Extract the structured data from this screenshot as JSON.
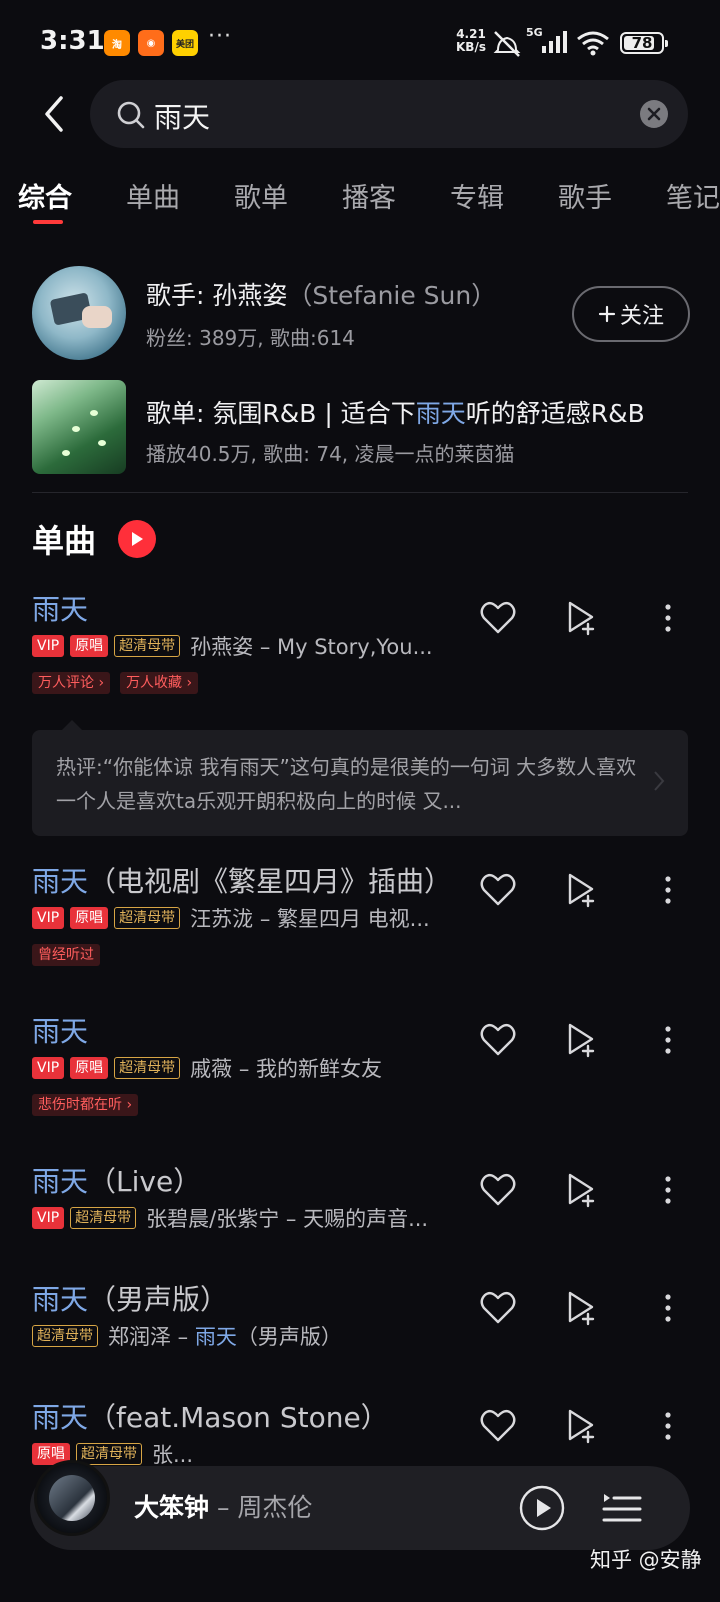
{
  "status_bar": {
    "time": "3:31",
    "apps": [
      {
        "name": "taobao-icon",
        "color": "#ff8a00",
        "glyph": "淘"
      },
      {
        "name": "app-icon",
        "color": "#ff6d1a",
        "glyph": "◉"
      },
      {
        "name": "meituan-icon",
        "color": "#ffd000",
        "glyph": "美团"
      }
    ],
    "more": "···",
    "net_speed_value": "4.21",
    "net_speed_unit": "KB/s",
    "network": "5G",
    "battery": "78"
  },
  "search": {
    "query": "雨天"
  },
  "tabs": [
    {
      "label": "综合",
      "active": true
    },
    {
      "label": "单曲",
      "active": false
    },
    {
      "label": "歌单",
      "active": false
    },
    {
      "label": "播客",
      "active": false
    },
    {
      "label": "专辑",
      "active": false
    },
    {
      "label": "歌手",
      "active": false
    },
    {
      "label": "笔记",
      "active": false
    }
  ],
  "artist_card": {
    "prefix": "歌手: ",
    "name": "孙燕姿",
    "en_name": "（Stefanie Sun）",
    "stats": "粉丝: 389万, 歌曲:614",
    "follow_label": "关注"
  },
  "playlist_card": {
    "title_before": "歌单: 氛围R&B | 适合下",
    "title_highlight": "雨天",
    "title_after": "听的舒适感R&B",
    "stats": "播放40.5万, 歌曲: 74, 凌晨一点的莱茵猫"
  },
  "section": {
    "title": "单曲"
  },
  "songs": [
    {
      "title": "雨天",
      "subtitle": "",
      "badges": [
        "VIP",
        "原唱",
        "超清母带"
      ],
      "artist": "孙燕姿 – My Story,You...",
      "tags": [
        "万人评论 ›",
        "万人收藏 ›"
      ]
    },
    {
      "title": "雨天",
      "subtitle": "（电视剧《繁星四月》插曲）",
      "badges": [
        "VIP",
        "原唱",
        "超清母带"
      ],
      "artist": "汪苏泷 – 繁星四月 电视...",
      "tags": [
        "曾经听过"
      ]
    },
    {
      "title": "雨天",
      "subtitle": "",
      "badges": [
        "VIP",
        "原唱",
        "超清母带"
      ],
      "artist": "戚薇 – 我的新鲜女友",
      "tags": [
        "悲伤时都在听 ›"
      ]
    },
    {
      "title": "雨天",
      "subtitle": "（Live）",
      "badges": [
        "VIP",
        "超清母带"
      ],
      "artist": "张碧晨/张紫宁 – 天赐的声音...",
      "tags": []
    },
    {
      "title": "雨天",
      "subtitle": "（男声版）",
      "badges": [
        "超清母带"
      ],
      "artist_before": "郑润泽 – ",
      "artist_highlight": "雨天",
      "artist_after": "（男声版）",
      "tags": []
    },
    {
      "title": "雨天",
      "subtitle": "（feat.Mason Stone）",
      "badges": [
        "原唱",
        "超清母带"
      ],
      "artist": "张...",
      "tags": []
    }
  ],
  "hot_comment": {
    "text": "热评:“你能体谅 我有雨天”这句真的是很美的一句词 大多数人喜欢一个人是喜欢ta乐观开朗积极向上的时候 又..."
  },
  "player": {
    "song": "大笨钟",
    "artist": " – 周杰伦"
  },
  "watermark": "知乎 @安静",
  "colors": {
    "accent": "#ff2f3a",
    "highlight": "#7fa8e6",
    "background": "#0c0c10"
  }
}
